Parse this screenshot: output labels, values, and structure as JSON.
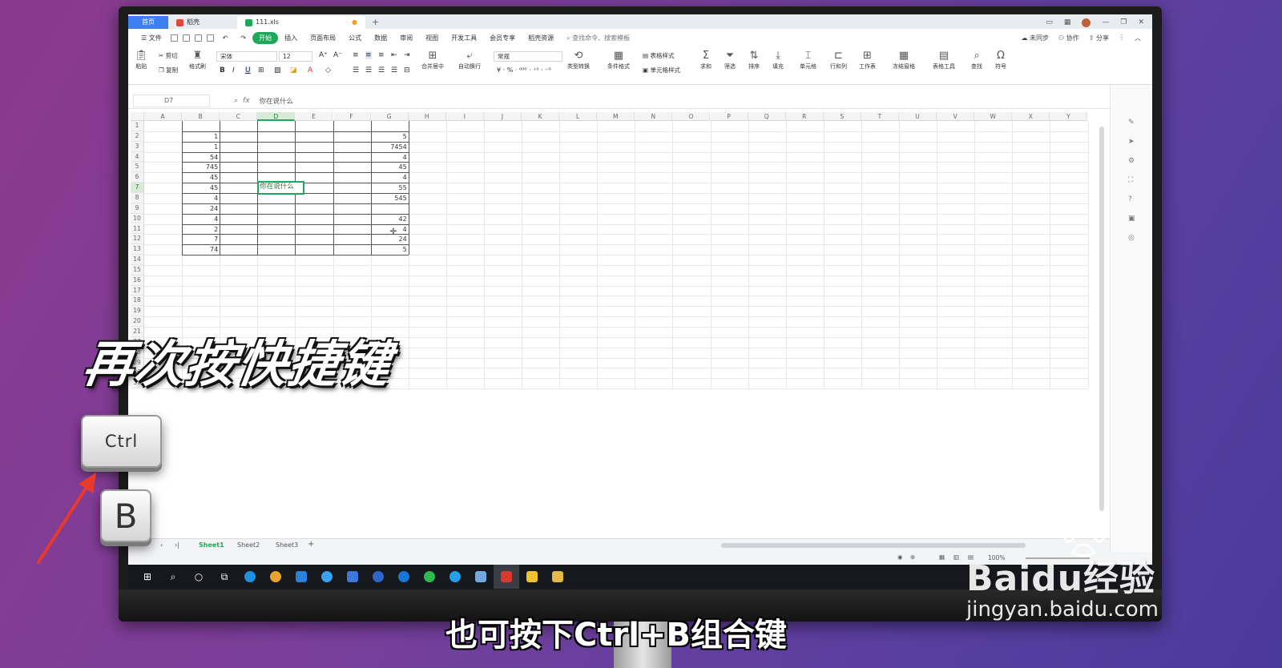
{
  "titlebar": {
    "home_tab": "首页",
    "doc_tab": "稻壳",
    "file_tab": "111.xls",
    "add_tab": "+"
  },
  "menu": {
    "file": "文件",
    "items": [
      "开始",
      "插入",
      "页面布局",
      "公式",
      "数据",
      "审阅",
      "视图",
      "开发工具",
      "会员专享",
      "稻壳资源"
    ],
    "active": "开始",
    "search": "查找命令、搜索模板",
    "sync": "未同步",
    "collab": "协作",
    "share": "分享"
  },
  "ribbon": {
    "paste": "粘贴",
    "cut": "剪切",
    "copy": "复制",
    "format_painter": "格式刷",
    "font_name": "宋体",
    "font_size": "12",
    "merge_center": "合并居中",
    "wrap_text": "自动换行",
    "number_format": "常规",
    "type_convert": "类型转换",
    "cond_format": "条件格式",
    "table_style": "表格样式",
    "cell_style": "单元格样式",
    "sum": "求和",
    "filter": "筛选",
    "sort": "排序",
    "fill": "填充",
    "cell": "单元格",
    "row_col": "行和列",
    "worksheet": "工作表",
    "freeze": "冻结窗格",
    "table_tools": "表格工具",
    "find": "查找",
    "symbol": "符号"
  },
  "formula_bar": {
    "name_box": "D7",
    "fx": "fx",
    "value": "你在说什么"
  },
  "grid": {
    "columns": [
      "A",
      "B",
      "C",
      "D",
      "E",
      "F",
      "G",
      "H",
      "I",
      "J",
      "K",
      "L",
      "M",
      "N",
      "O",
      "P",
      "Q",
      "R",
      "S",
      "T",
      "U",
      "V",
      "W",
      "X",
      "Y"
    ],
    "selected_column": "D",
    "visible_rows": [
      "1",
      "2",
      "3",
      "4",
      "5",
      "6",
      "7",
      "8",
      "9",
      "10",
      "11",
      "12",
      "13",
      "14",
      "15",
      "16",
      "17",
      "18",
      "19",
      "20",
      "21",
      "27",
      "28",
      "29",
      "36",
      "37"
    ],
    "selected_row": "7",
    "column_b": [
      "",
      "1",
      "1",
      "54",
      "745",
      "45",
      "45",
      "4",
      "24",
      "4",
      "2",
      "7",
      "74"
    ],
    "column_g": [
      "",
      "5",
      "7454",
      "4",
      "45",
      "4",
      "55",
      "545",
      "",
      "42",
      "4",
      "24",
      "5"
    ],
    "active_cell_text": "你在说什么"
  },
  "sheets": {
    "tabs": [
      "Sheet1",
      "Sheet2",
      "Sheet3"
    ],
    "active": "Sheet1",
    "add": "+"
  },
  "status": {
    "zoom": "100%"
  },
  "overlay": {
    "headline": "再次按快捷键",
    "key_ctrl": "Ctrl",
    "key_b": "B",
    "caption": "也可按下Ctrl+B组合键",
    "watermark_logo": "Baidu经验",
    "watermark_url": "jingyan.baidu.com"
  },
  "colors": {
    "accent_green": "#1fa85a",
    "tab_blue": "#3d7ff3",
    "arrow_red": "#e8392c"
  }
}
